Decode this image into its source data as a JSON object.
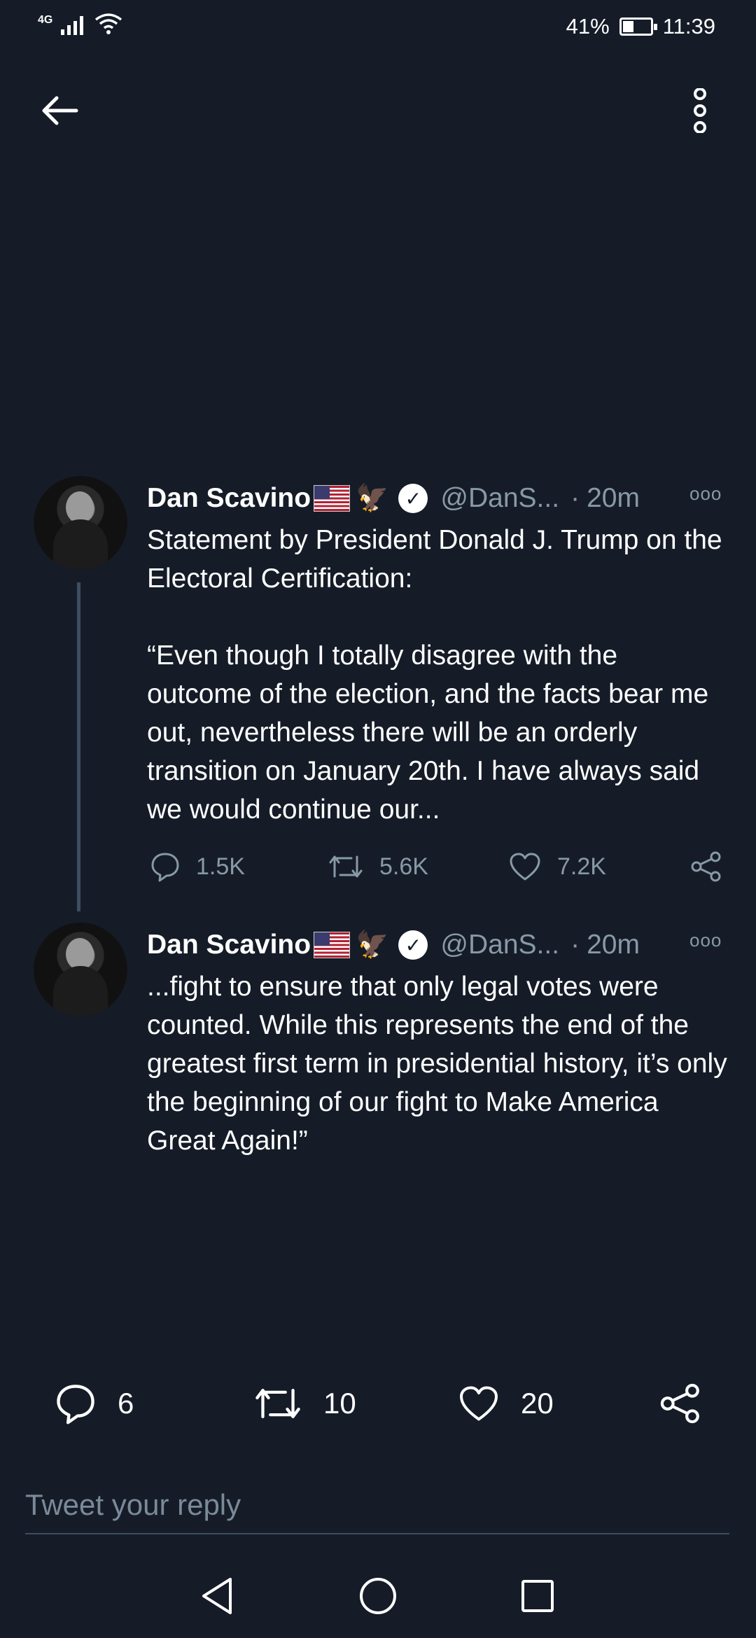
{
  "status_bar": {
    "network": "4G",
    "battery_percent": "41%",
    "battery_level": 0.41,
    "time": "11:39"
  },
  "header": {
    "back_icon": "arrow-left-icon",
    "more_icon": "more-vertical-icon"
  },
  "tweets": [
    {
      "name": "Dan Scavino",
      "emojis": [
        "us-flag",
        "eagle"
      ],
      "handle": "@DanS...",
      "dot": "·",
      "time": "20m",
      "more": "ooo",
      "text": "Statement by President Donald J. Trump on the Electoral Certification:\n\n“Even though I totally disagree with the outcome of the election, and the facts bear me out, nevertheless there will be an orderly transition on January 20th. I have always said we would continue our...",
      "replies": "1.5K",
      "retweets": "5.6K",
      "likes": "7.2K"
    },
    {
      "name": "Dan Scavino",
      "emojis": [
        "us-flag",
        "eagle"
      ],
      "handle": "@DanS...",
      "dot": "·",
      "time": "20m",
      "more": "ooo",
      "text": "...fight to ensure that only legal votes were counted. While this represents the end of the greatest first term in presidential history, it’s only the beginning of our fight to Make America Great Again!”"
    }
  ],
  "bottom_actions": {
    "replies": "6",
    "retweets": "10",
    "likes": "20"
  },
  "reply_box": {
    "placeholder": "Tweet your reply"
  },
  "colors": {
    "background": "#151c28",
    "muted": "#8899a6",
    "thread_line": "#3d4e60"
  }
}
